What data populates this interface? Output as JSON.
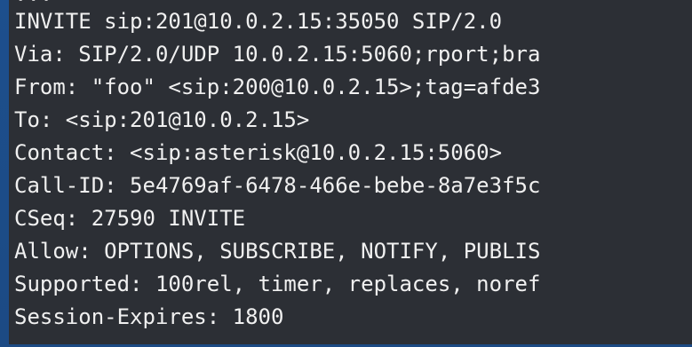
{
  "terminal": {
    "lines": [
      "...",
      "INVITE sip:201@10.0.2.15:35050 SIP/2.0",
      "Via: SIP/2.0/UDP 10.0.2.15:5060;rport;bra",
      "From: \"foo\" <sip:200@10.0.2.15>;tag=afde3",
      "To: <sip:201@10.0.2.15>",
      "Contact: <sip:asterisk@10.0.2.15:5060>",
      "Call-ID: 5e4769af-6478-466e-bebe-8a7e3f5c",
      "CSeq: 27590 INVITE",
      "Allow: OPTIONS, SUBSCRIBE, NOTIFY, PUBLIS",
      "Supported: 100rel, timer, replaces, noref",
      "Session-Expires: 1800"
    ]
  }
}
